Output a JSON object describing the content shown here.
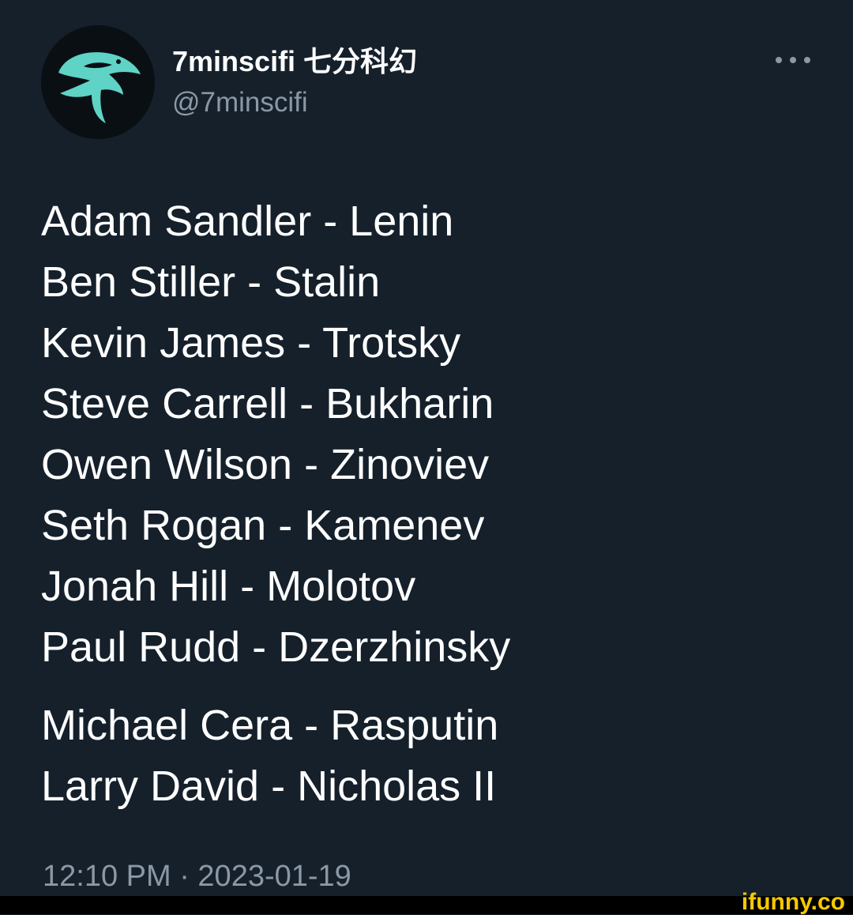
{
  "tweet": {
    "display_name": "7minscifi 七分科幻",
    "handle": "@7minscifi",
    "more_icon": "more-horizontal-icon",
    "lines": [
      "Adam Sandler - Lenin",
      "Ben Stiller - Stalin",
      "Kevin James - Trotsky",
      "Steve Carrell - Bukharin",
      "Owen Wilson - Zinoviev",
      "Seth Rogan - Kamenev",
      "Jonah Hill - Molotov",
      "Paul Rudd - Dzerzhinsky",
      "Michael Cera - Rasputin",
      "Larry David - Nicholas II"
    ],
    "timestamp": "12:10 PM · 2023-01-19"
  },
  "watermark": "ifunny.co",
  "colors": {
    "background": "#15202b",
    "text": "#ffffff",
    "muted": "#8b98a5",
    "avatar_accent": "#5fd3c6",
    "watermark": "#f5c900"
  }
}
